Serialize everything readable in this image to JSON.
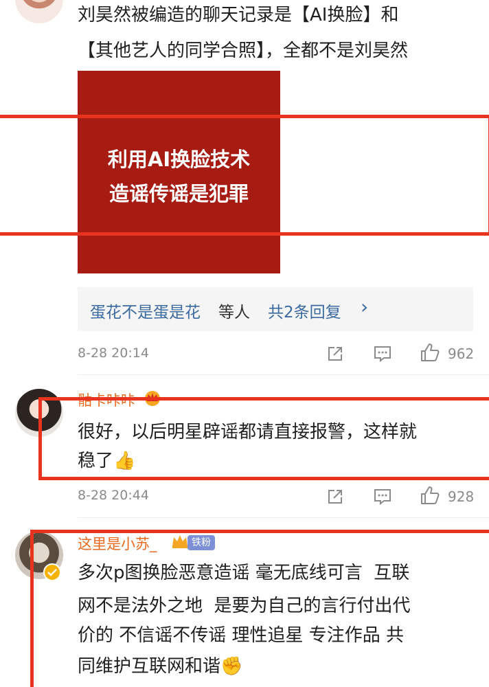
{
  "comment_1": {
    "text_lines": [
      "刘昊然被编造的聊天记录是【AI换脸】和",
      "【其他艺人的同学合照】，全都不是刘昊然"
    ],
    "image_card": {
      "line1": "利用AI换脸技术",
      "line2": "造谣传谣是犯罪",
      "bg_color": "#a61c12"
    },
    "replies": {
      "user": "蛋花不是蛋是花",
      "suffix": "等人",
      "count_text": "共2条回复",
      "chevron": "›"
    },
    "timestamp": "8-28 20:14",
    "likes": "962"
  },
  "comment_2": {
    "username": "骷卡咔咔",
    "text_lines": [
      "很好，以后明星辟谣都请直接报警，这样就",
      "稳了👍"
    ],
    "timestamp": "8-28 20:44",
    "likes": "928"
  },
  "comment_3": {
    "username": "这里是小苏_",
    "fan_badge": "铁粉",
    "text_lines": [
      "多次p图换脸恶意造谣 毫无底线可言  互联",
      "网不是法外之地  是要为自己的言行付出代",
      "价的 不信谣不传谣 理性追星 专注作品 共",
      "同维护互联网和谐✊"
    ]
  },
  "icons": {
    "share": "share-icon",
    "comment": "comment-icon",
    "like": "thumbs-up-icon",
    "crown": "crown-icon",
    "verified": "verified-icon"
  },
  "colors": {
    "link_blue": "#3b6aa0",
    "username_orange": "#e86a1f",
    "highlight_red": "#e8331f",
    "meta_gray": "#8a8a8a"
  }
}
